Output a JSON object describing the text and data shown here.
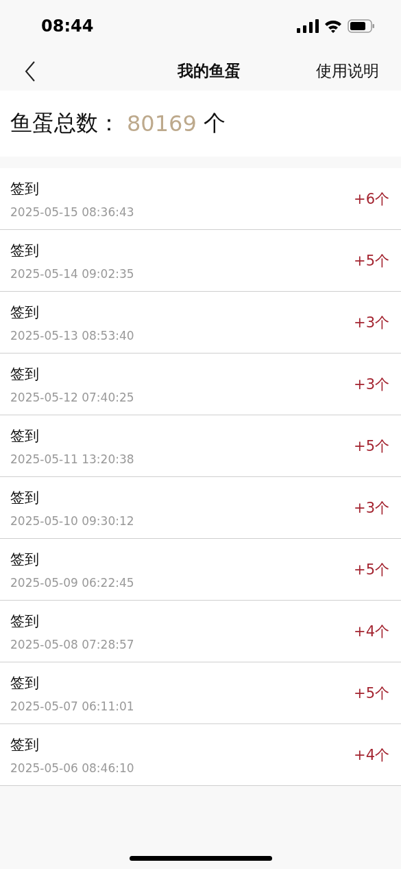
{
  "status_bar": {
    "time": "08:44"
  },
  "nav": {
    "title": "我的鱼蛋",
    "action": "使用说明"
  },
  "total": {
    "label": "鱼蛋总数：",
    "value": "80169",
    "unit": "个"
  },
  "records": [
    {
      "title": "签到",
      "time": "2025-05-15 08:36:43",
      "amount": "+6个"
    },
    {
      "title": "签到",
      "time": "2025-05-14 09:02:35",
      "amount": "+5个"
    },
    {
      "title": "签到",
      "time": "2025-05-13 08:53:40",
      "amount": "+3个"
    },
    {
      "title": "签到",
      "time": "2025-05-12 07:40:25",
      "amount": "+3个"
    },
    {
      "title": "签到",
      "time": "2025-05-11 13:20:38",
      "amount": "+5个"
    },
    {
      "title": "签到",
      "time": "2025-05-10 09:30:12",
      "amount": "+3个"
    },
    {
      "title": "签到",
      "time": "2025-05-09 06:22:45",
      "amount": "+5个"
    },
    {
      "title": "签到",
      "time": "2025-05-08 07:28:57",
      "amount": "+4个"
    },
    {
      "title": "签到",
      "time": "2025-05-07 06:11:01",
      "amount": "+5个"
    },
    {
      "title": "签到",
      "time": "2025-05-06 08:46:10",
      "amount": "+4个"
    }
  ]
}
